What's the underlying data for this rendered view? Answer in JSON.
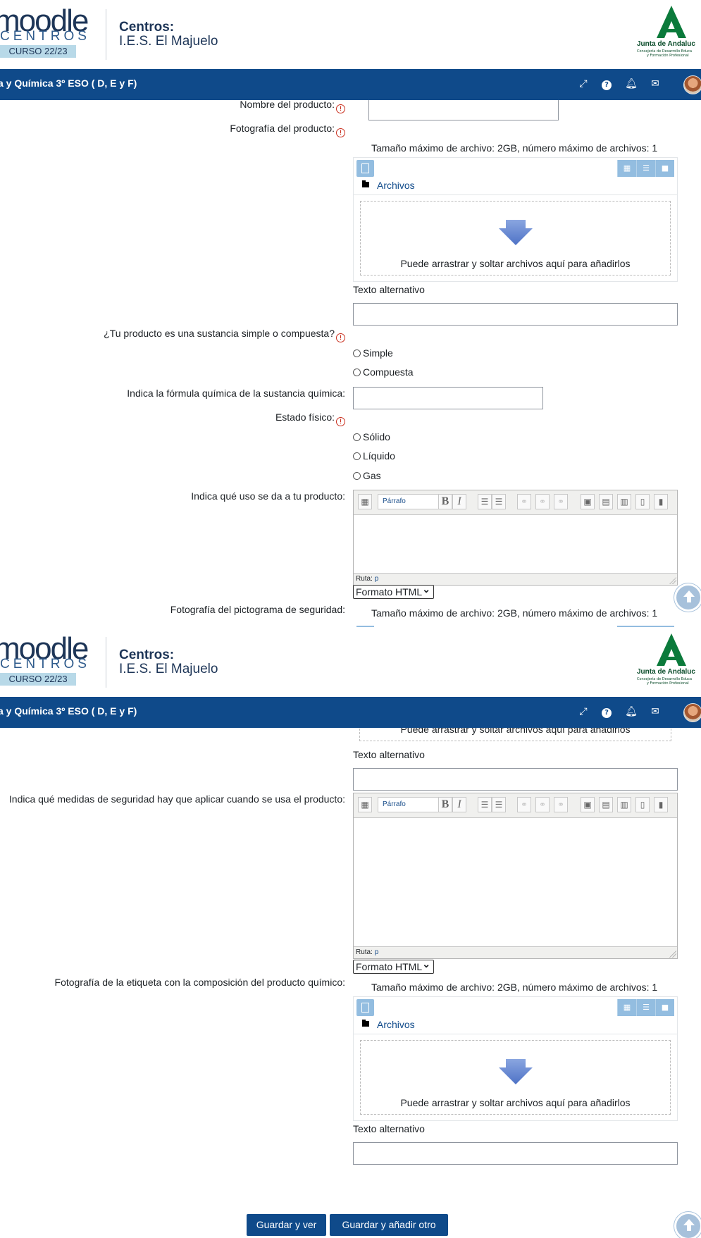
{
  "header": {
    "logo_main": "moodle",
    "logo_sub": "CENTROS",
    "course_year": "CURSO 22/23",
    "centros_title": "Centros:",
    "school_name": "I.E.S. El Majuelo",
    "junta_name": "Junta de Andaluc",
    "junta_sub1": "Consejería de Desarrollo Educa",
    "junta_sub2": "y Formación Profesional"
  },
  "navbar": {
    "course_title": "a y Química 3º ESO ( D, E y F)",
    "icons": [
      "expand-icon",
      "help-icon",
      "bell-icon",
      "mail-icon",
      "avatar"
    ]
  },
  "form": {
    "product_name_label": "Nombre del producto:",
    "product_photo_label": "Fotografía del producto:",
    "filemanager_limits": "Tamaño máximo de archivo: 2GB, número máximo de archivos: 1",
    "files_folder": "Archivos",
    "drop_text": "Puede arrastrar y soltar archivos aquí para añadirlos",
    "alt_text_label": "Texto alternativo",
    "substance_question": "¿Tu producto es una sustancia simple o compuesta?",
    "substance_options": [
      "Simple",
      "Compuesta"
    ],
    "formula_label": "Indica la fórmula química de la sustancia química:",
    "state_label": "Estado físico:",
    "state_options": [
      "Sólido",
      "Líquido",
      "Gas"
    ],
    "use_label": "Indica qué uso se da a tu producto:",
    "editor_format": "Párrafo",
    "editor_path_label": "Ruta:",
    "editor_path_value": "p",
    "format_select": "Formato HTML",
    "pictogram_label": "Fotografía del pictograma de seguridad:",
    "safety_label": "Indica qué medidas de seguridad hay que aplicar cuando se usa el producto:",
    "label_photo_label": "Fotografía de la etiqueta con la composición del producto químico:"
  },
  "buttons": {
    "save_view": "Guardar y ver",
    "save_add": "Guardar y añadir otro"
  }
}
